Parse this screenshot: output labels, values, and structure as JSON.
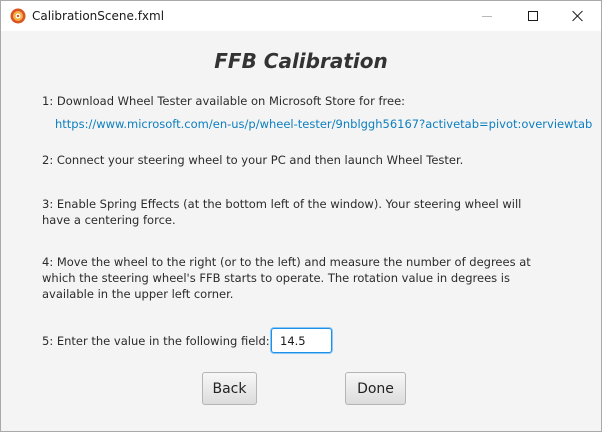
{
  "window": {
    "title": "CalibrationScene.fxml",
    "app_icon": "app-logo-icon",
    "controls": {
      "minimize_icon": "minimize-icon",
      "maximize_icon": "maximize-icon",
      "close_icon": "close-icon"
    }
  },
  "main": {
    "heading": "FFB Calibration",
    "steps": [
      "1: Download Wheel Tester available on Microsoft Store for free:",
      "2: Connect your steering wheel to your PC and then launch Wheel Tester.",
      "3: Enable Spring Effects (at the bottom left of the window). Your steering wheel will have a centering force.",
      "4: Move the wheel to the right (or to the left) and measure the number of degrees at which the steering wheel's FFB starts to operate. The rotation value in degrees is available in the upper left corner.",
      "5: Enter the value in the following field:"
    ],
    "store_link": "https://www.microsoft.com/en-us/p/wheel-tester/9nblggh56167?activetab=pivot:overviewtab",
    "value_input": "14.5",
    "buttons": {
      "back": "Back",
      "done": "Done"
    }
  },
  "colors": {
    "link": "#0d7fbf",
    "focus_border": "#1e90e8",
    "background": "#f4f4f4"
  }
}
